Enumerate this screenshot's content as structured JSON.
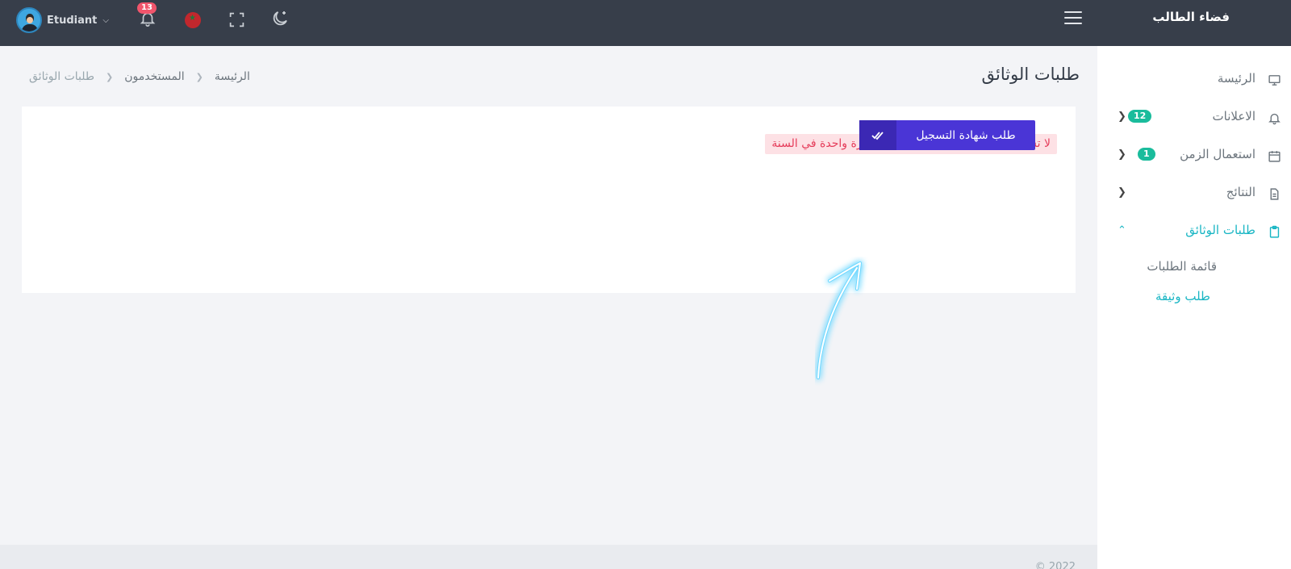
{
  "topbar": {
    "brand": "فضاء الطالب",
    "user_name": "Etudiant",
    "notifications_count": "13"
  },
  "sidebar": {
    "items": [
      {
        "label": "الرئيسة",
        "icon": "monitor-icon"
      },
      {
        "label": "الاعلانات",
        "icon": "bell-icon",
        "badge": "12"
      },
      {
        "label": "استعمال الزمن",
        "icon": "calendar-icon",
        "badge": "1"
      },
      {
        "label": "النتائج",
        "icon": "file-text-icon"
      },
      {
        "label": "طلبات الوثائق",
        "icon": "clipboard-icon"
      }
    ],
    "sub_items": [
      {
        "label": "قائمة الطلبات"
      },
      {
        "label": "طلب وثيقة"
      }
    ]
  },
  "page": {
    "title": "طلبات الوثائق",
    "breadcrumb": [
      "الرئيسة",
      "المستخدمون",
      "طلبات الوثائق"
    ]
  },
  "card": {
    "alert": "لا تسلم مختلف الوثائق المطلوبة سوى مرة واحدة في السنة",
    "button_label": "طلب شهادة التسجيل"
  },
  "footer": {
    "text": "© 2022"
  },
  "colors": {
    "topbar": "#373e4a",
    "accent": "#19b6c4",
    "badge_green": "#1abc9c",
    "button": "#4a35d6",
    "alert_text": "#e53c5a"
  }
}
